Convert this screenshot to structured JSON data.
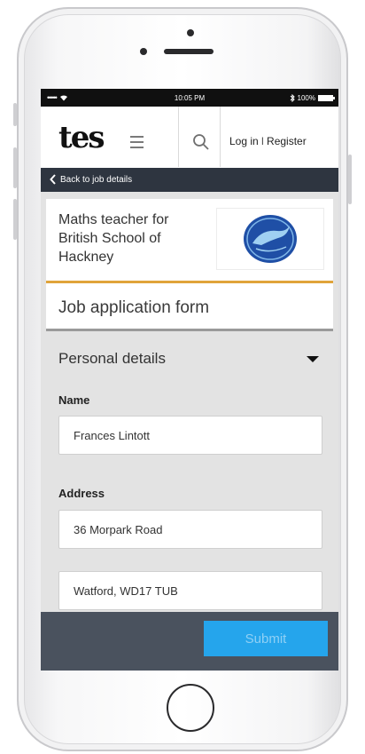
{
  "status_bar": {
    "signal": "•••••",
    "time": "10:05 PM",
    "battery_percent": "100%"
  },
  "header": {
    "logo_text": "tes",
    "login_label": "Log in",
    "separator": "I",
    "register_label": "Register"
  },
  "back_link": {
    "label": "Back to job details"
  },
  "job": {
    "title": "Maths teacher for British School of Hackney"
  },
  "form": {
    "title": "Job application form",
    "section_title": "Personal details",
    "name_label": "Name",
    "name_value": "Frances Lintott",
    "address_label": "Address",
    "address_line1_value": "36 Morpark Road",
    "address_line2_value": "Watford, WD17 TUB"
  },
  "footer": {
    "submit_label": "Submit"
  },
  "colors": {
    "accent_orange": "#e0a43a",
    "submit_blue": "#25a5ec",
    "dark_bar": "#2e3540",
    "footer_bar": "#4a525e",
    "school_logo_blue": "#1f4fa6"
  },
  "icons": [
    "wifi-icon",
    "bluetooth-icon",
    "battery-icon",
    "menu-icon",
    "search-icon",
    "chevron-left-icon",
    "caret-down-icon",
    "dolphin-logo"
  ]
}
